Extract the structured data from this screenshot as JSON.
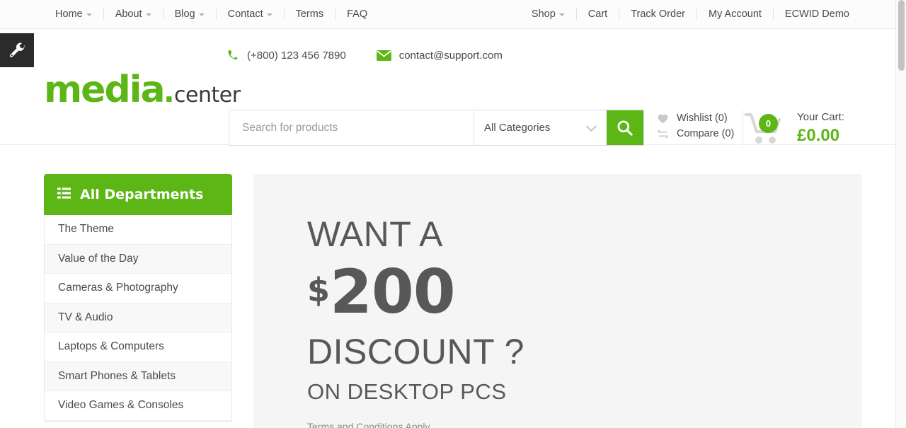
{
  "topnav": {
    "left": [
      {
        "label": "Home",
        "caret": true,
        "icon": "chevron-down-icon"
      },
      {
        "label": "About",
        "caret": true,
        "icon": "chevron-down-icon"
      },
      {
        "label": "Blog",
        "caret": true,
        "icon": "chevron-down-icon"
      },
      {
        "label": "Contact",
        "caret": true,
        "icon": "chevron-down-icon"
      },
      {
        "label": "Terms",
        "caret": false,
        "icon": ""
      },
      {
        "label": "FAQ",
        "caret": false,
        "icon": ""
      }
    ],
    "right": [
      {
        "label": "Shop",
        "caret": true,
        "icon": "chevron-down-icon"
      },
      {
        "label": "Cart",
        "caret": false,
        "icon": ""
      },
      {
        "label": "Track Order",
        "caret": false,
        "icon": ""
      },
      {
        "label": "My Account",
        "caret": false,
        "icon": ""
      },
      {
        "label": "ECWID Demo",
        "caret": false,
        "icon": ""
      }
    ]
  },
  "dev_badge": {
    "icon": "wrench-icon",
    "bg": "#2b2b2b"
  },
  "header": {
    "logo": {
      "primary": "media",
      "dot": ".",
      "secondary": "center",
      "color": "#5cb615"
    },
    "contact": {
      "phone_icon": "phone-icon",
      "phone": "(+800) 123 456 7890",
      "email_icon": "envelope-icon",
      "email": "contact@support.com"
    },
    "search": {
      "placeholder": "Search for products",
      "value": "",
      "category_selected": "All Categories",
      "category_chevron": "chevron-down-icon",
      "button_icon": "search-icon",
      "button_color": "#5cb615"
    },
    "links": [
      {
        "icon": "heart-icon",
        "label": "Wishlist (0)"
      },
      {
        "icon": "compare-icon",
        "label": "Compare (0)"
      }
    ],
    "cart": {
      "icon": "shopping-cart-icon",
      "badge_count": "0",
      "label": "Your Cart:",
      "total": "£0.00",
      "total_color": "#5cb615"
    }
  },
  "sidebar": {
    "header": {
      "icon": "list-icon",
      "label": "All Departments",
      "color": "#5cb615"
    },
    "items": [
      {
        "label": "The Theme"
      },
      {
        "label": "Value of the Day"
      },
      {
        "label": "Cameras & Photography"
      },
      {
        "label": "TV & Audio"
      },
      {
        "label": "Laptops & Computers"
      },
      {
        "label": "Smart Phones & Tablets"
      },
      {
        "label": "Video Games & Consoles"
      }
    ]
  },
  "banner": {
    "line1": "WANT A",
    "currency": "$",
    "amount": "200",
    "line3": "DISCOUNT ?",
    "line4": "ON DESKTOP PCS",
    "terms": "Terms and Conditions Apply",
    "background": "#f5f5f5"
  },
  "scrollbar": {
    "thumb_top": 0,
    "thumb_height": 100
  }
}
